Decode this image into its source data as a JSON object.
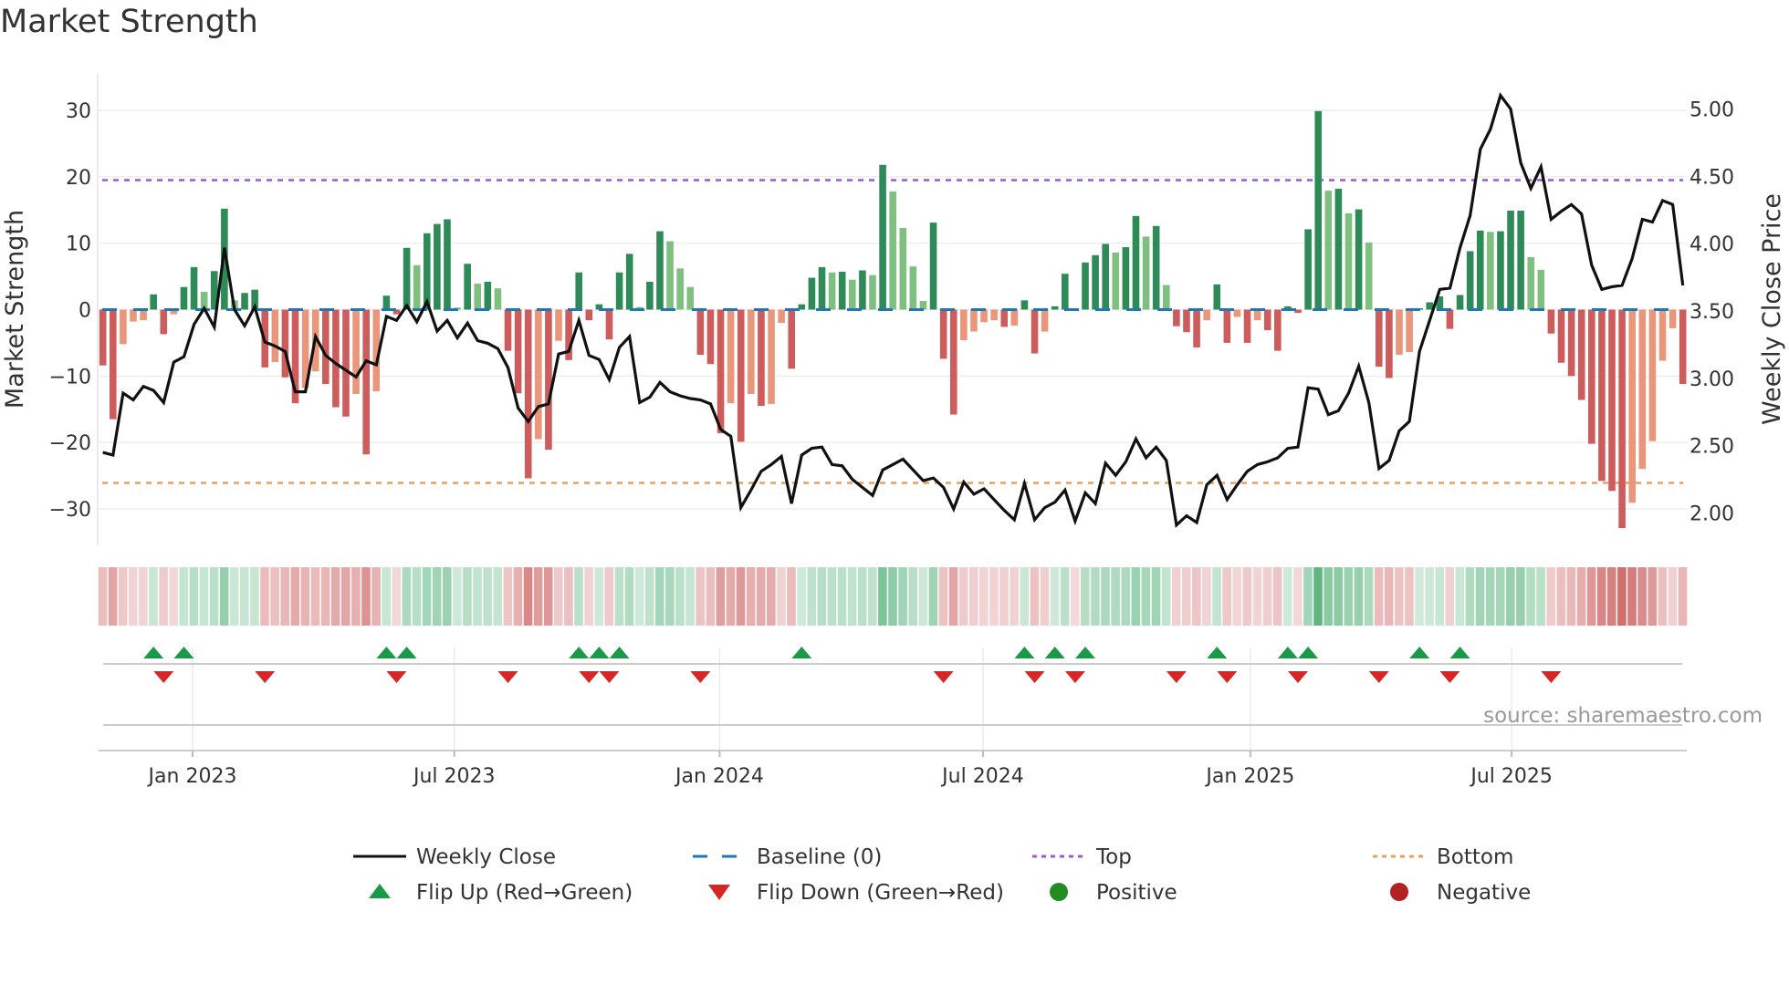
{
  "title": "Market Strength",
  "source": "source: sharemaestro.com",
  "colors": {
    "pos_strong": "#2e8b57",
    "pos_weak": "#7fbf7f",
    "neg_strong": "#cd5c5c",
    "neg_weak": "#e9967a",
    "price_line": "#111111",
    "baseline": "#1f77b4",
    "top": "#9b59d6",
    "bottom": "#e8a060",
    "flip_up": "#1a9a48",
    "flip_down": "#d62728",
    "heat_pos": "#2ca05a",
    "heat_neg": "#c85050",
    "positive": "#228b22",
    "negative": "#b22222"
  },
  "chart_data": {
    "type": "bar",
    "title": "Market Strength",
    "ylabel": "Market Strength",
    "y2label": "Weekly Close Price",
    "ylim": [
      -35.5,
      35.5
    ],
    "y2lim": [
      1.76,
      5.26
    ],
    "yticks": [
      30,
      20,
      10,
      0,
      -10,
      -20,
      -30
    ],
    "ytick_labels": [
      "30",
      "20",
      "10",
      "0",
      "−10",
      "−20",
      "−30"
    ],
    "y2ticks": [
      5.0,
      4.5,
      4.0,
      3.5,
      3.0,
      2.5,
      2.0
    ],
    "y2tick_labels": [
      "5.00",
      "4.50",
      "4.00",
      "3.50",
      "3.00",
      "2.50",
      "2.00"
    ],
    "xticks": [
      {
        "week": 8.86,
        "label": "Jan 2023"
      },
      {
        "week": 34.7,
        "label": "Jul 2023"
      },
      {
        "week": 60.9,
        "label": "Jan 2024"
      },
      {
        "week": 86.9,
        "label": "Jul 2024"
      },
      {
        "week": 113.3,
        "label": "Jan 2025"
      },
      {
        "week": 139.1,
        "label": "Jul 2025"
      }
    ],
    "top_level": 19.5,
    "bottom_level": -26.1,
    "baseline": 0,
    "grid": true,
    "legend_position": "bottom",
    "strength": [
      -8.4,
      -16.5,
      -5.2,
      -1.8,
      -1.6,
      2.3,
      -3.7,
      -0.7,
      3.4,
      6.4,
      2.7,
      5.8,
      15.2,
      1.4,
      2.5,
      3.0,
      -8.7,
      -7.9,
      -10.2,
      -14.1,
      -11.8,
      -9.3,
      -11.2,
      -14.7,
      -16.1,
      -12.7,
      -21.8,
      -12.3,
      2.1,
      -0.7,
      9.3,
      6.7,
      11.5,
      12.9,
      13.6,
      0.3,
      6.9,
      3.9,
      4.2,
      3.2,
      -6.2,
      -12.6,
      -25.4,
      -19.5,
      -21.1,
      -4.7,
      -7.6,
      5.6,
      -1.6,
      0.8,
      -4.5,
      5.6,
      8.4,
      0.4,
      4.2,
      11.8,
      10.3,
      6.2,
      3.4,
      -6.8,
      -8.2,
      -18.6,
      -14.1,
      -19.9,
      -12.7,
      -14.5,
      -14.2,
      -2.0,
      -8.9,
      0.8,
      4.8,
      6.4,
      5.6,
      5.7,
      4.5,
      5.9,
      5.2,
      21.8,
      17.8,
      12.3,
      6.5,
      1.3,
      13.1,
      -7.4,
      -15.8,
      -4.6,
      -3.3,
      -1.9,
      -1.6,
      -2.6,
      -2.4,
      1.4,
      -6.6,
      -3.3,
      0.5,
      5.4,
      -0.2,
      7.1,
      8.2,
      9.9,
      8.6,
      9.4,
      14.1,
      11.0,
      12.6,
      3.7,
      -2.5,
      -3.4,
      -5.7,
      -1.6,
      3.8,
      -5.0,
      -1.1,
      -5.0,
      -1.6,
      -3.1,
      -6.2,
      0.5,
      -0.5,
      12.1,
      29.9,
      17.9,
      18.2,
      14.5,
      15.1,
      10.1,
      -8.6,
      -10.3,
      -6.8,
      -6.4,
      0.2,
      1.1,
      2.0,
      -2.9,
      2.2,
      8.8,
      11.9,
      11.7,
      11.8,
      14.9,
      14.9,
      7.9,
      6.0,
      -3.6,
      -8.0,
      -10.0,
      -13.6,
      -20.2,
      -25.8,
      -27.3,
      -32.9,
      -29.1,
      -24.0,
      -19.8,
      -7.7,
      -2.8,
      -11.2
    ],
    "weekly_close": [
      2.45,
      2.43,
      2.89,
      2.84,
      2.94,
      2.91,
      2.82,
      3.12,
      3.16,
      3.4,
      3.52,
      3.38,
      3.97,
      3.51,
      3.39,
      3.53,
      3.27,
      3.24,
      3.2,
      2.9,
      2.9,
      3.31,
      3.17,
      3.11,
      3.06,
      3.01,
      3.13,
      3.1,
      3.46,
      3.43,
      3.54,
      3.42,
      3.57,
      3.35,
      3.43,
      3.3,
      3.41,
      3.28,
      3.26,
      3.22,
      3.08,
      2.78,
      2.68,
      2.79,
      2.81,
      3.18,
      3.2,
      3.43,
      3.17,
      3.14,
      2.99,
      3.23,
      3.31,
      2.82,
      2.86,
      2.97,
      2.9,
      2.87,
      2.85,
      2.84,
      2.81,
      2.62,
      2.57,
      2.04,
      2.17,
      2.31,
      2.36,
      2.42,
      2.07,
      2.43,
      2.48,
      2.49,
      2.36,
      2.35,
      2.25,
      2.19,
      2.13,
      2.32,
      2.36,
      2.4,
      2.32,
      2.24,
      2.26,
      2.19,
      2.03,
      2.23,
      2.14,
      2.18,
      2.1,
      2.02,
      1.95,
      2.22,
      1.95,
      2.04,
      2.08,
      2.17,
      1.94,
      2.15,
      2.07,
      2.37,
      2.28,
      2.38,
      2.55,
      2.41,
      2.49,
      2.39,
      1.91,
      1.98,
      1.93,
      2.21,
      2.28,
      2.1,
      2.21,
      2.31,
      2.36,
      2.38,
      2.41,
      2.48,
      2.49,
      2.93,
      2.92,
      2.73,
      2.76,
      2.89,
      3.09,
      2.82,
      2.33,
      2.39,
      2.61,
      2.68,
      3.2,
      3.43,
      3.66,
      3.67,
      3.97,
      4.21,
      4.7,
      4.85,
      5.1,
      5.0,
      4.6,
      4.41,
      4.57,
      4.18,
      4.24,
      4.29,
      4.22,
      3.84,
      3.66,
      3.68,
      3.69,
      3.89,
      4.18,
      4.16,
      4.32,
      4.29,
      3.69
    ],
    "legend": [
      {
        "key": "weekly_close",
        "label": "Weekly Close",
        "symbol": "line"
      },
      {
        "key": "baseline",
        "label": "Baseline (0)",
        "symbol": "dash"
      },
      {
        "key": "top",
        "label": "Top",
        "symbol": "dot"
      },
      {
        "key": "bottom",
        "label": "Bottom",
        "symbol": "dot"
      },
      {
        "key": "flip_up",
        "label": "Flip Up (Red→Green)",
        "symbol": "tri-up"
      },
      {
        "key": "flip_down",
        "label": "Flip Down (Green→Red)",
        "symbol": "tri-down"
      },
      {
        "key": "positive",
        "label": "Positive",
        "symbol": "circle"
      },
      {
        "key": "negative",
        "label": "Negative",
        "symbol": "circle"
      }
    ]
  }
}
